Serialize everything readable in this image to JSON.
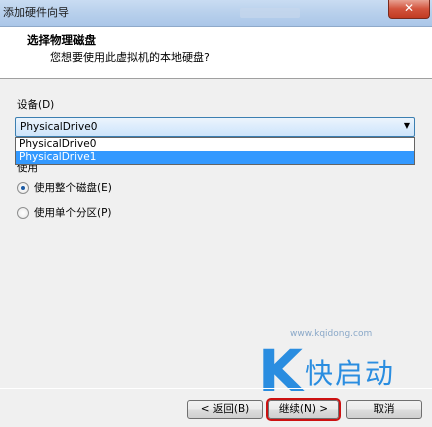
{
  "window": {
    "title": "添加硬件向导",
    "close_glyph": "✕"
  },
  "header": {
    "title": "选择物理磁盘",
    "subtitle": "您想要使用此虚拟机的本地硬盘?"
  },
  "device": {
    "label": "设备(D)",
    "selected": "PhysicalDrive0",
    "options": [
      "PhysicalDrive0",
      "PhysicalDrive1"
    ],
    "highlighted_option": "PhysicalDrive1"
  },
  "usage": {
    "label": "使用",
    "options": [
      {
        "label": "使用整个磁盘(E)",
        "checked": true
      },
      {
        "label": "使用单个分区(P)",
        "checked": false
      }
    ]
  },
  "watermark": {
    "letter": "K",
    "text": "快启动",
    "url": "www.kqidong.com"
  },
  "buttons": {
    "back": "< 返回(B)",
    "next": "继续(N) >",
    "cancel": "取消"
  }
}
